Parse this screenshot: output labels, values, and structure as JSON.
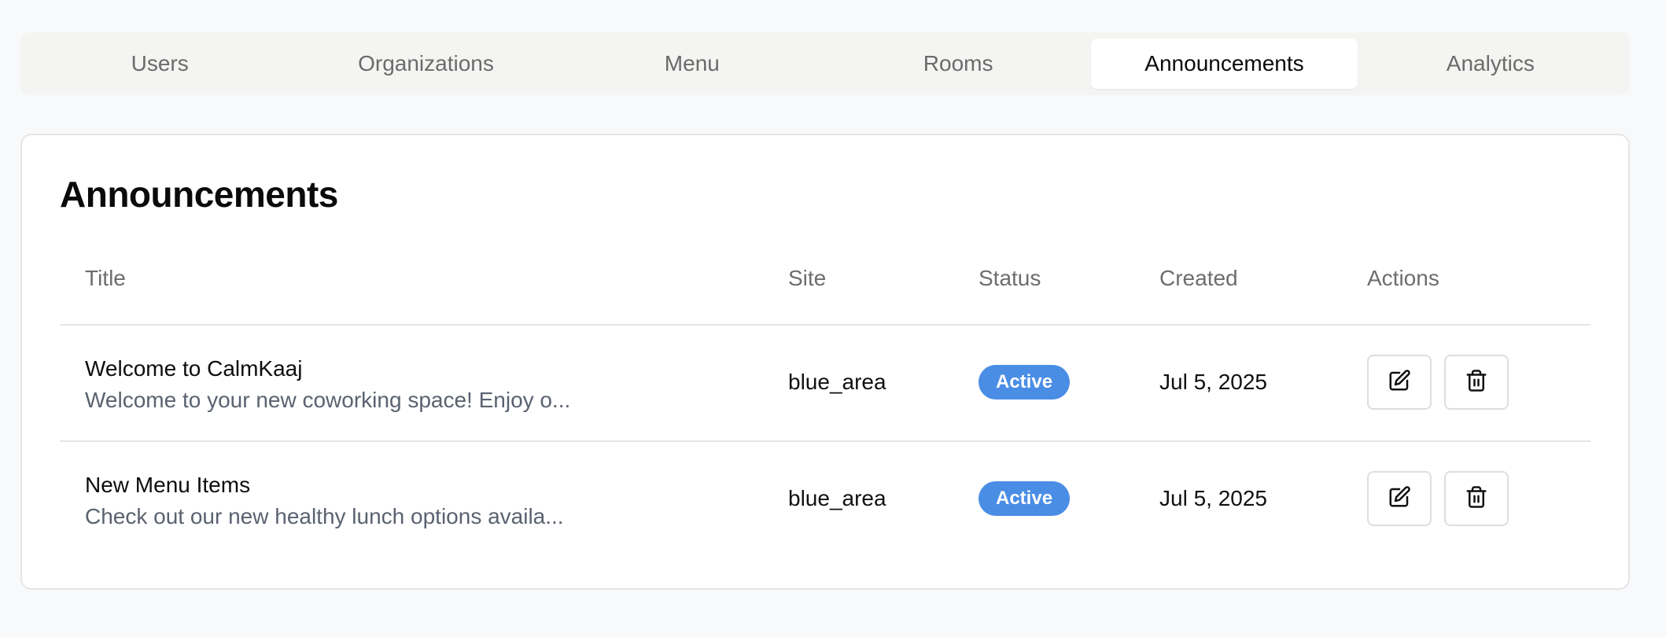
{
  "tabs": [
    {
      "label": "Users",
      "active": false
    },
    {
      "label": "Organizations",
      "active": false
    },
    {
      "label": "Menu",
      "active": false
    },
    {
      "label": "Rooms",
      "active": false
    },
    {
      "label": "Announcements",
      "active": true
    },
    {
      "label": "Analytics",
      "active": false
    }
  ],
  "page": {
    "title": "Announcements"
  },
  "table": {
    "headers": {
      "title": "Title",
      "site": "Site",
      "status": "Status",
      "created": "Created",
      "actions": "Actions"
    },
    "rows": [
      {
        "title": "Welcome to CalmKaaj",
        "description": "Welcome to your new coworking space! Enjoy o...",
        "site": "blue_area",
        "status": "Active",
        "created": "Jul 5, 2025",
        "actions": [
          "edit-icon",
          "trash-icon"
        ]
      },
      {
        "title": "New Menu Items",
        "description": "Check out our new healthy lunch options availa...",
        "site": "blue_area",
        "status": "Active",
        "created": "Jul 5, 2025",
        "actions": [
          "edit-icon",
          "trash-icon"
        ]
      }
    ]
  },
  "colors": {
    "background": "#f8f9fb",
    "tab_bar": "#f4f4f2",
    "status_active": "#4a8de5",
    "muted_text": "#6d6d6d",
    "border": "#e5e5e5"
  }
}
